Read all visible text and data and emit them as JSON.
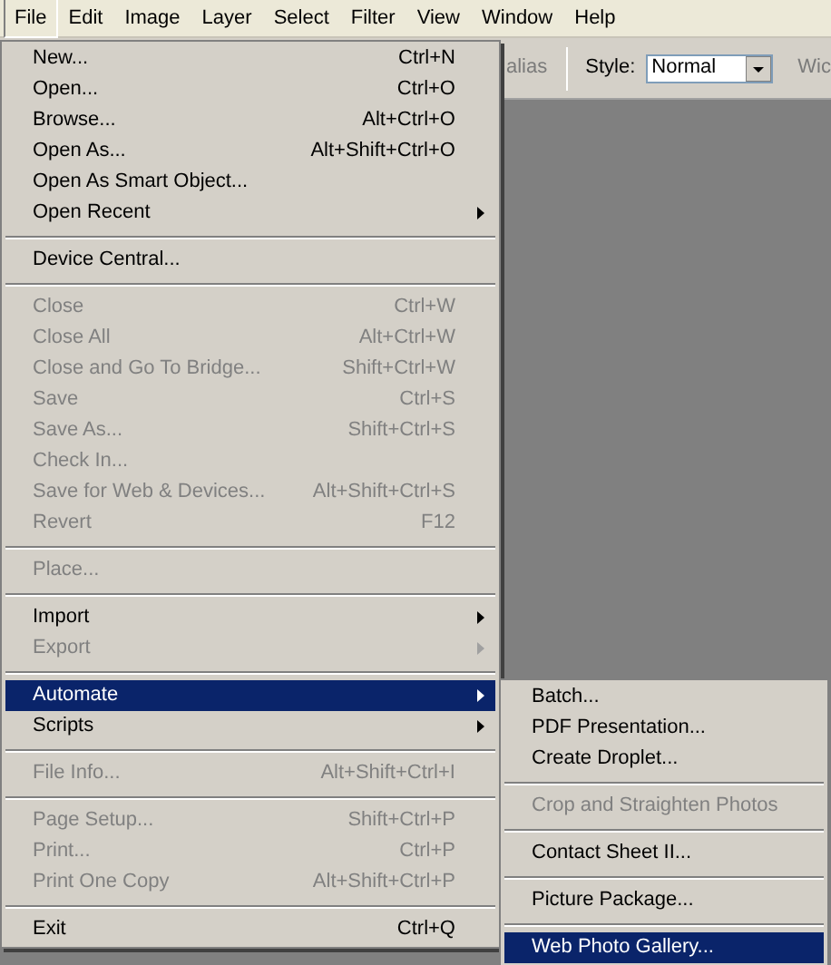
{
  "menu_bar": [
    {
      "label": "File",
      "selected": true
    },
    {
      "label": "Edit",
      "selected": false
    },
    {
      "label": "Image",
      "selected": false
    },
    {
      "label": "Layer",
      "selected": false
    },
    {
      "label": "Select",
      "selected": false
    },
    {
      "label": "Filter",
      "selected": false
    },
    {
      "label": "View",
      "selected": false
    },
    {
      "label": "Window",
      "selected": false
    },
    {
      "label": "Help",
      "selected": false
    }
  ],
  "options_bar": {
    "partial_label": "alias",
    "style_label": "Style:",
    "style_value": "Normal",
    "cut_label": "Wic"
  },
  "file_menu": [
    {
      "kind": "item",
      "label": "New...",
      "shortcut": "Ctrl+N",
      "disabled": false,
      "submenu": false,
      "selected": false
    },
    {
      "kind": "item",
      "label": "Open...",
      "shortcut": "Ctrl+O",
      "disabled": false,
      "submenu": false,
      "selected": false
    },
    {
      "kind": "item",
      "label": "Browse...",
      "shortcut": "Alt+Ctrl+O",
      "disabled": false,
      "submenu": false,
      "selected": false
    },
    {
      "kind": "item",
      "label": "Open As...",
      "shortcut": "Alt+Shift+Ctrl+O",
      "disabled": false,
      "submenu": false,
      "selected": false
    },
    {
      "kind": "item",
      "label": "Open As Smart Object...",
      "disabled": false,
      "submenu": false,
      "selected": false
    },
    {
      "kind": "item",
      "label": "Open Recent",
      "disabled": false,
      "submenu": true,
      "selected": false
    },
    {
      "kind": "separator"
    },
    {
      "kind": "item",
      "label": "Device Central...",
      "disabled": false,
      "submenu": false,
      "selected": false
    },
    {
      "kind": "separator"
    },
    {
      "kind": "item",
      "label": "Close",
      "shortcut": "Ctrl+W",
      "disabled": true,
      "submenu": false,
      "selected": false
    },
    {
      "kind": "item",
      "label": "Close All",
      "shortcut": "Alt+Ctrl+W",
      "disabled": true,
      "submenu": false,
      "selected": false
    },
    {
      "kind": "item",
      "label": "Close and Go To Bridge...",
      "shortcut": "Shift+Ctrl+W",
      "disabled": true,
      "submenu": false,
      "selected": false
    },
    {
      "kind": "item",
      "label": "Save",
      "shortcut": "Ctrl+S",
      "disabled": true,
      "submenu": false,
      "selected": false
    },
    {
      "kind": "item",
      "label": "Save As...",
      "shortcut": "Shift+Ctrl+S",
      "disabled": true,
      "submenu": false,
      "selected": false
    },
    {
      "kind": "item",
      "label": "Check In...",
      "disabled": true,
      "submenu": false,
      "selected": false
    },
    {
      "kind": "item",
      "label": "Save for Web & Devices...",
      "shortcut": "Alt+Shift+Ctrl+S",
      "disabled": true,
      "submenu": false,
      "selected": false
    },
    {
      "kind": "item",
      "label": "Revert",
      "shortcut": "F12",
      "disabled": true,
      "submenu": false,
      "selected": false
    },
    {
      "kind": "separator"
    },
    {
      "kind": "item",
      "label": "Place...",
      "disabled": true,
      "submenu": false,
      "selected": false
    },
    {
      "kind": "separator"
    },
    {
      "kind": "item",
      "label": "Import",
      "disabled": false,
      "submenu": true,
      "selected": false
    },
    {
      "kind": "item",
      "label": "Export",
      "disabled": true,
      "submenu": true,
      "selected": false
    },
    {
      "kind": "separator"
    },
    {
      "kind": "item",
      "label": "Automate",
      "disabled": false,
      "submenu": true,
      "selected": true
    },
    {
      "kind": "item",
      "label": "Scripts",
      "disabled": false,
      "submenu": true,
      "selected": false
    },
    {
      "kind": "separator"
    },
    {
      "kind": "item",
      "label": "File Info...",
      "shortcut": "Alt+Shift+Ctrl+I",
      "disabled": true,
      "submenu": false,
      "selected": false
    },
    {
      "kind": "separator"
    },
    {
      "kind": "item",
      "label": "Page Setup...",
      "shortcut": "Shift+Ctrl+P",
      "disabled": true,
      "submenu": false,
      "selected": false
    },
    {
      "kind": "item",
      "label": "Print...",
      "shortcut": "Ctrl+P",
      "disabled": true,
      "submenu": false,
      "selected": false
    },
    {
      "kind": "item",
      "label": "Print One Copy",
      "shortcut": "Alt+Shift+Ctrl+P",
      "disabled": true,
      "submenu": false,
      "selected": false
    },
    {
      "kind": "separator"
    },
    {
      "kind": "item",
      "label": "Exit",
      "shortcut": "Ctrl+Q",
      "disabled": false,
      "submenu": false,
      "selected": false
    }
  ],
  "automate_submenu": [
    {
      "kind": "item",
      "label": "Batch...",
      "disabled": false,
      "selected": false
    },
    {
      "kind": "item",
      "label": "PDF Presentation...",
      "disabled": false,
      "selected": false
    },
    {
      "kind": "item",
      "label": "Create Droplet...",
      "disabled": false,
      "selected": false
    },
    {
      "kind": "separator"
    },
    {
      "kind": "item",
      "label": "Crop and Straighten Photos",
      "disabled": true,
      "selected": false
    },
    {
      "kind": "separator"
    },
    {
      "kind": "item",
      "label": "Contact Sheet II...",
      "disabled": false,
      "selected": false
    },
    {
      "kind": "separator"
    },
    {
      "kind": "item",
      "label": "Picture Package...",
      "disabled": false,
      "selected": false
    },
    {
      "kind": "separator"
    },
    {
      "kind": "item",
      "label": "Web Photo Gallery...",
      "disabled": false,
      "selected": true
    }
  ]
}
